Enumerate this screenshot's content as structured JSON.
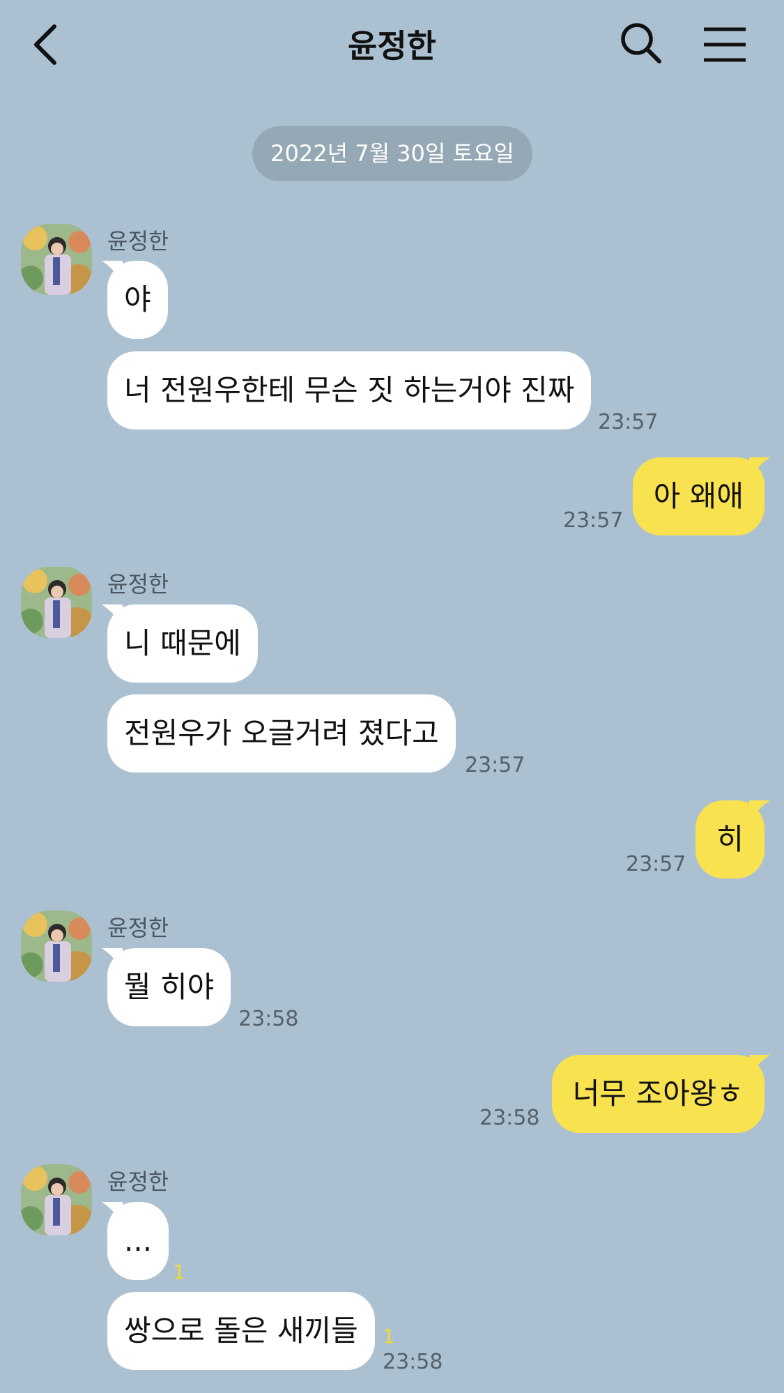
{
  "header": {
    "title": "윤정한",
    "back_icon": "chevron-left-icon",
    "search_icon": "search-icon",
    "menu_icon": "hamburger-menu-icon"
  },
  "date_divider": "2022년 7월 30일 토요일",
  "colors": {
    "background": "#abc1d1",
    "incoming_bubble": "#ffffff",
    "outgoing_bubble": "#f9e24f",
    "unread_count": "#f1da3e"
  },
  "messages": [
    {
      "sender": "윤정한",
      "bubbles": [
        "야",
        "너 전원우한테 무슨 짓 하는거야 진짜"
      ],
      "time": "23:57"
    },
    {
      "outgoing": true,
      "text": "아 왜애",
      "time": "23:57"
    },
    {
      "sender": "윤정한",
      "bubbles": [
        "니 때문에",
        "전원우가 오글거려 졌다고"
      ],
      "time": "23:57"
    },
    {
      "outgoing": true,
      "text": "히",
      "time": "23:57"
    },
    {
      "sender": "윤정한",
      "bubbles": [
        "뭘 히야"
      ],
      "time": "23:58"
    },
    {
      "outgoing": true,
      "text": "너무 조아왕ㅎ",
      "time": "23:58"
    },
    {
      "sender": "윤정한",
      "bubbles": [
        "...",
        "쌍으로 돌은 새끼들"
      ],
      "unread": [
        "1",
        "1"
      ],
      "time": "23:58"
    }
  ]
}
